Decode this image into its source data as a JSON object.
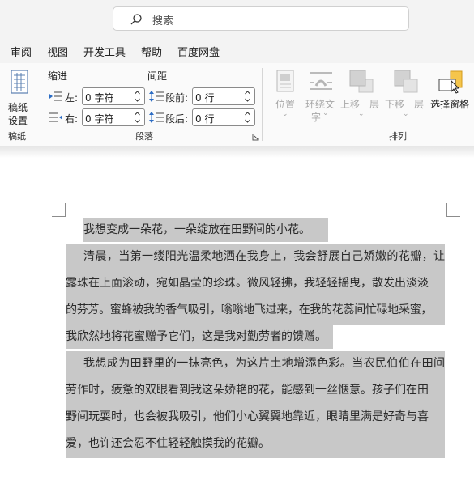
{
  "search": {
    "placeholder": "搜索"
  },
  "menu": [
    "审阅",
    "视图",
    "开发工具",
    "帮助",
    "百度网盘"
  ],
  "ribbon": {
    "paper": {
      "label_line1": "稿纸",
      "label_line2": "设置",
      "group": "稿纸"
    },
    "paragraph": {
      "indent_header": "缩进",
      "spacing_header": "间距",
      "left_label": "左:",
      "right_label": "右:",
      "before_label": "段前:",
      "after_label": "段后:",
      "left_value": "0 字符",
      "right_value": "0 字符",
      "before_value": "0 行",
      "after_value": "0 行",
      "group": "段落"
    },
    "arrange": {
      "position": "位置",
      "wrap_line1": "环绕文",
      "wrap_line2": "字",
      "bring_forward": "上移一层",
      "send_backward": "下移一层",
      "selection_pane": "选择窗格",
      "group": "排列"
    }
  },
  "document": {
    "lines": [
      "我想变成一朵花，一朵绽放在田野间的小花。",
      "清晨，当第一缕阳光温柔地洒在我身上，我会舒展自己娇嫩的花瓣，让",
      "露珠在上面滚动，宛如晶莹的珍珠。微风轻拂，我轻轻摇曳，散发出淡淡",
      "的芬芳。蜜蜂被我的香气吸引，嗡嗡地飞过来，在我的花蕊间忙碌地采蜜，",
      "我欣然地将花蜜赠予它们，这是我对勤劳者的馈赠。",
      "我想成为田野里的一抹亮色，为这片土地增添色彩。当农民伯伯在田间",
      "劳作时，疲惫的双眼看到我这朵娇艳的花，能感到一丝惬意。孩子们在田",
      "野间玩耍时，也会被我吸引，他们小心翼翼地靠近，眼睛里满是好奇与喜",
      "爱，也许还会忍不住轻轻触摸我的花瓣。"
    ]
  }
}
